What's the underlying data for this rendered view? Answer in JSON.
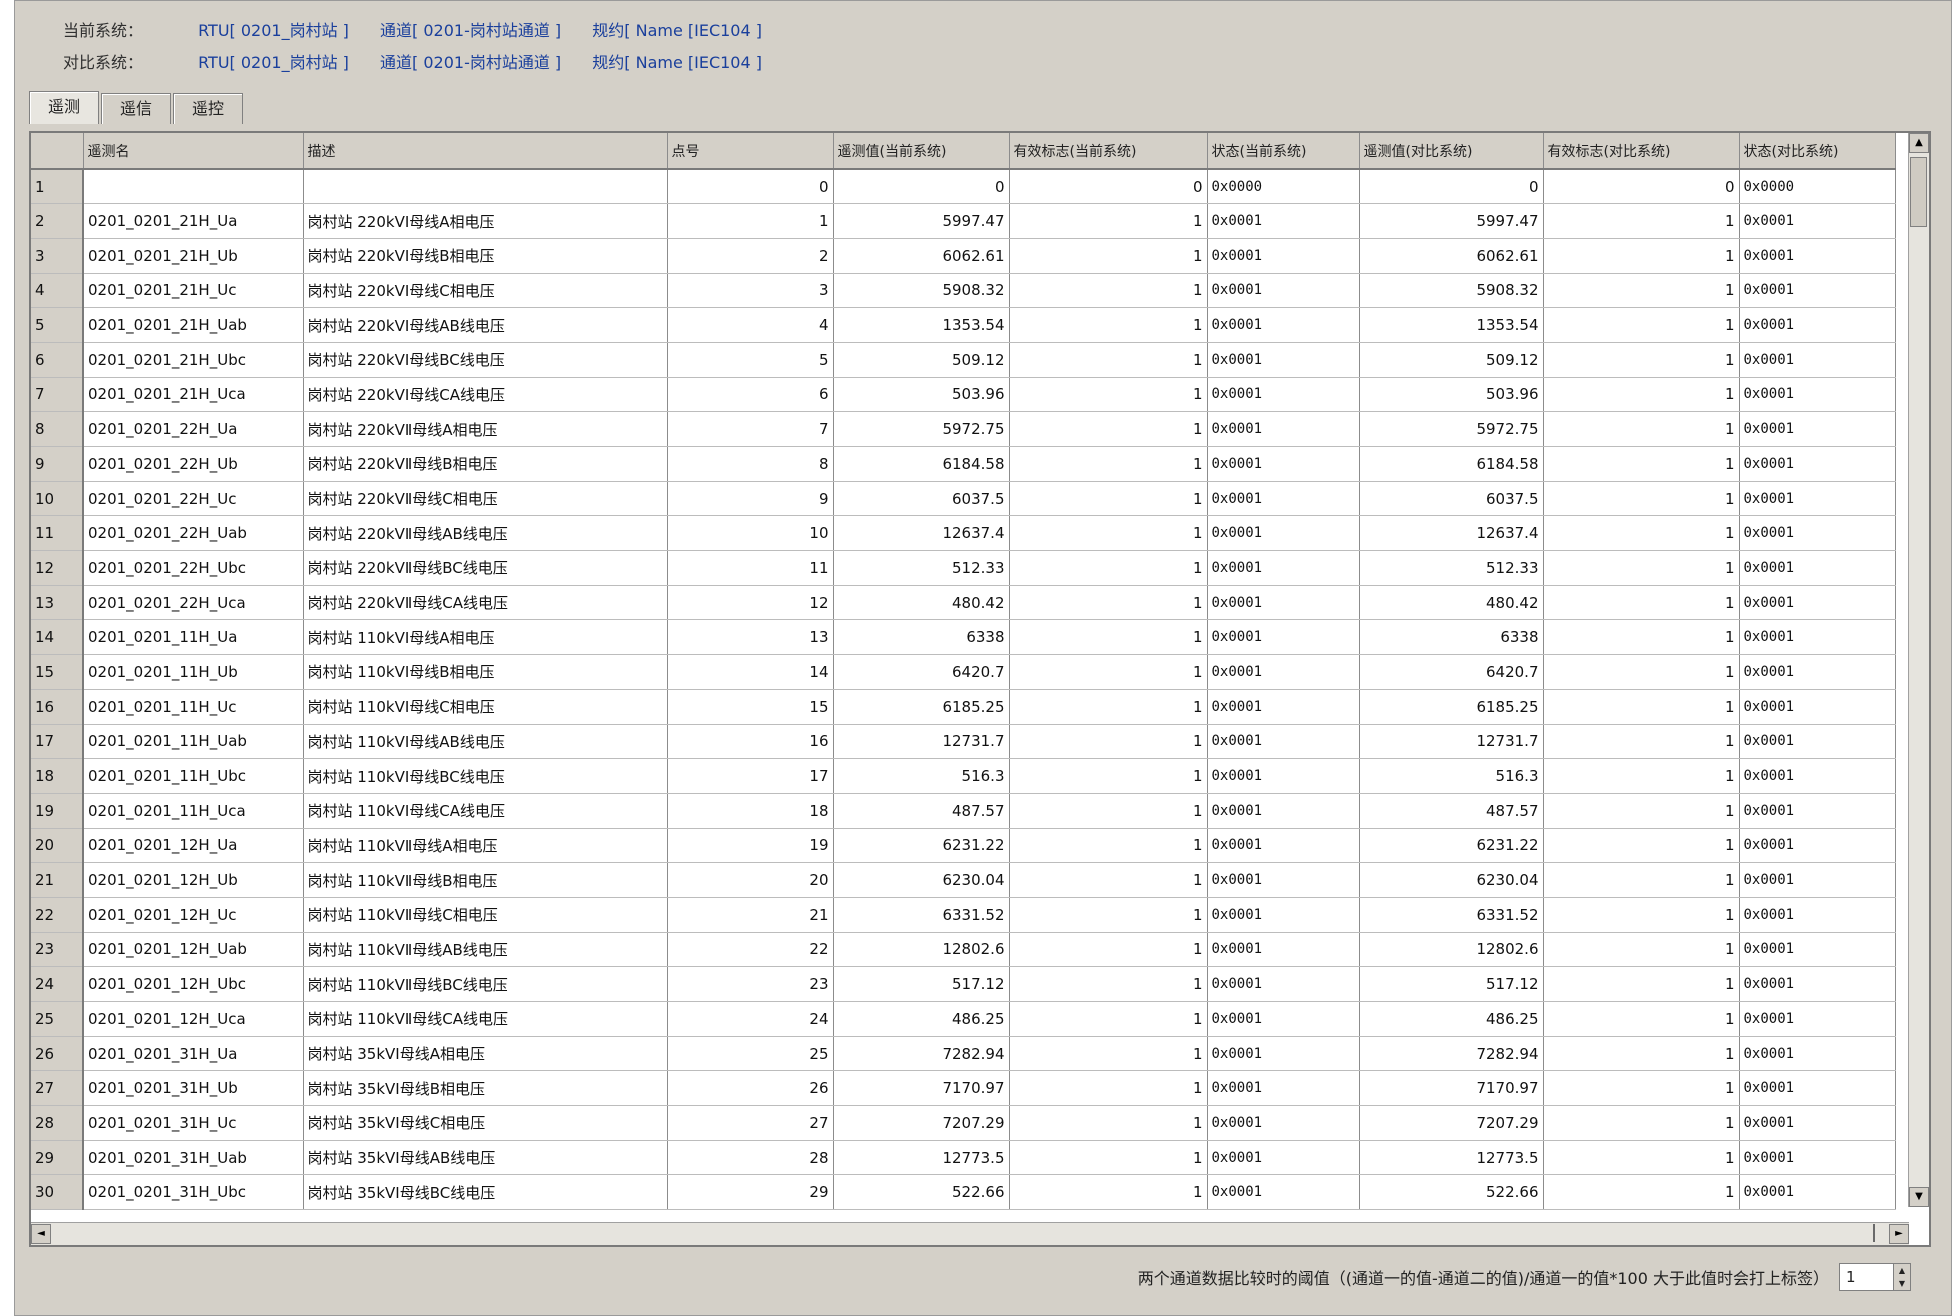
{
  "header": {
    "current_label": "当前系统：",
    "current_rtu": "RTU[ 0201_岗村站 ]",
    "current_channel": "通道[ 0201-岗村站通道 ]",
    "current_protocol": "规约[ Name [IEC104 ]",
    "compare_label": "对比系统：",
    "compare_rtu": "RTU[ 0201_岗村站 ]",
    "compare_channel": "通道[ 0201-岗村站通道 ]",
    "compare_protocol": "规约[ Name [IEC104 ]"
  },
  "tabs": [
    "遥测",
    "遥信",
    "遥控"
  ],
  "columns": [
    "遥测名",
    "描述",
    "点号",
    "遥测值(当前系统)",
    "有效标志(当前系统)",
    "状态(当前系统)",
    "遥测值(对比系统)",
    "有效标志(对比系统)",
    "状态(对比系统)"
  ],
  "rows": [
    [
      "1",
      "",
      "",
      "0",
      "0",
      "0",
      "0x0000",
      "0",
      "0",
      "0x0000"
    ],
    [
      "2",
      "0201_0201_21H_Ua",
      "岗村站 220kVⅠ母线A相电压",
      "1",
      "5997.47",
      "1",
      "0x0001",
      "5997.47",
      "1",
      "0x0001"
    ],
    [
      "3",
      "0201_0201_21H_Ub",
      "岗村站 220kVⅠ母线B相电压",
      "2",
      "6062.61",
      "1",
      "0x0001",
      "6062.61",
      "1",
      "0x0001"
    ],
    [
      "4",
      "0201_0201_21H_Uc",
      "岗村站 220kVⅠ母线C相电压",
      "3",
      "5908.32",
      "1",
      "0x0001",
      "5908.32",
      "1",
      "0x0001"
    ],
    [
      "5",
      "0201_0201_21H_Uab",
      "岗村站 220kVⅠ母线AB线电压",
      "4",
      "1353.54",
      "1",
      "0x0001",
      "1353.54",
      "1",
      "0x0001"
    ],
    [
      "6",
      "0201_0201_21H_Ubc",
      "岗村站 220kVⅠ母线BC线电压",
      "5",
      "509.12",
      "1",
      "0x0001",
      "509.12",
      "1",
      "0x0001"
    ],
    [
      "7",
      "0201_0201_21H_Uca",
      "岗村站 220kVⅠ母线CA线电压",
      "6",
      "503.96",
      "1",
      "0x0001",
      "503.96",
      "1",
      "0x0001"
    ],
    [
      "8",
      "0201_0201_22H_Ua",
      "岗村站 220kVⅡ母线A相电压",
      "7",
      "5972.75",
      "1",
      "0x0001",
      "5972.75",
      "1",
      "0x0001"
    ],
    [
      "9",
      "0201_0201_22H_Ub",
      "岗村站 220kVⅡ母线B相电压",
      "8",
      "6184.58",
      "1",
      "0x0001",
      "6184.58",
      "1",
      "0x0001"
    ],
    [
      "10",
      "0201_0201_22H_Uc",
      "岗村站 220kVⅡ母线C相电压",
      "9",
      "6037.5",
      "1",
      "0x0001",
      "6037.5",
      "1",
      "0x0001"
    ],
    [
      "11",
      "0201_0201_22H_Uab",
      "岗村站 220kVⅡ母线AB线电压",
      "10",
      "12637.4",
      "1",
      "0x0001",
      "12637.4",
      "1",
      "0x0001"
    ],
    [
      "12",
      "0201_0201_22H_Ubc",
      "岗村站 220kVⅡ母线BC线电压",
      "11",
      "512.33",
      "1",
      "0x0001",
      "512.33",
      "1",
      "0x0001"
    ],
    [
      "13",
      "0201_0201_22H_Uca",
      "岗村站 220kVⅡ母线CA线电压",
      "12",
      "480.42",
      "1",
      "0x0001",
      "480.42",
      "1",
      "0x0001"
    ],
    [
      "14",
      "0201_0201_11H_Ua",
      "岗村站 110kVⅠ母线A相电压",
      "13",
      "6338",
      "1",
      "0x0001",
      "6338",
      "1",
      "0x0001"
    ],
    [
      "15",
      "0201_0201_11H_Ub",
      "岗村站 110kVⅠ母线B相电压",
      "14",
      "6420.7",
      "1",
      "0x0001",
      "6420.7",
      "1",
      "0x0001"
    ],
    [
      "16",
      "0201_0201_11H_Uc",
      "岗村站 110kVⅠ母线C相电压",
      "15",
      "6185.25",
      "1",
      "0x0001",
      "6185.25",
      "1",
      "0x0001"
    ],
    [
      "17",
      "0201_0201_11H_Uab",
      "岗村站 110kVⅠ母线AB线电压",
      "16",
      "12731.7",
      "1",
      "0x0001",
      "12731.7",
      "1",
      "0x0001"
    ],
    [
      "18",
      "0201_0201_11H_Ubc",
      "岗村站 110kVⅠ母线BC线电压",
      "17",
      "516.3",
      "1",
      "0x0001",
      "516.3",
      "1",
      "0x0001"
    ],
    [
      "19",
      "0201_0201_11H_Uca",
      "岗村站 110kVⅠ母线CA线电压",
      "18",
      "487.57",
      "1",
      "0x0001",
      "487.57",
      "1",
      "0x0001"
    ],
    [
      "20",
      "0201_0201_12H_Ua",
      "岗村站 110kVⅡ母线A相电压",
      "19",
      "6231.22",
      "1",
      "0x0001",
      "6231.22",
      "1",
      "0x0001"
    ],
    [
      "21",
      "0201_0201_12H_Ub",
      "岗村站 110kVⅡ母线B相电压",
      "20",
      "6230.04",
      "1",
      "0x0001",
      "6230.04",
      "1",
      "0x0001"
    ],
    [
      "22",
      "0201_0201_12H_Uc",
      "岗村站 110kVⅡ母线C相电压",
      "21",
      "6331.52",
      "1",
      "0x0001",
      "6331.52",
      "1",
      "0x0001"
    ],
    [
      "23",
      "0201_0201_12H_Uab",
      "岗村站 110kVⅡ母线AB线电压",
      "22",
      "12802.6",
      "1",
      "0x0001",
      "12802.6",
      "1",
      "0x0001"
    ],
    [
      "24",
      "0201_0201_12H_Ubc",
      "岗村站 110kVⅡ母线BC线电压",
      "23",
      "517.12",
      "1",
      "0x0001",
      "517.12",
      "1",
      "0x0001"
    ],
    [
      "25",
      "0201_0201_12H_Uca",
      "岗村站 110kVⅡ母线CA线电压",
      "24",
      "486.25",
      "1",
      "0x0001",
      "486.25",
      "1",
      "0x0001"
    ],
    [
      "26",
      "0201_0201_31H_Ua",
      "岗村站 35kVⅠ母线A相电压",
      "25",
      "7282.94",
      "1",
      "0x0001",
      "7282.94",
      "1",
      "0x0001"
    ],
    [
      "27",
      "0201_0201_31H_Ub",
      "岗村站 35kVⅠ母线B相电压",
      "26",
      "7170.97",
      "1",
      "0x0001",
      "7170.97",
      "1",
      "0x0001"
    ],
    [
      "28",
      "0201_0201_31H_Uc",
      "岗村站 35kVⅠ母线C相电压",
      "27",
      "7207.29",
      "1",
      "0x0001",
      "7207.29",
      "1",
      "0x0001"
    ],
    [
      "29",
      "0201_0201_31H_Uab",
      "岗村站 35kVⅠ母线AB线电压",
      "28",
      "12773.5",
      "1",
      "0x0001",
      "12773.5",
      "1",
      "0x0001"
    ],
    [
      "30",
      "0201_0201_31H_Ubc",
      "岗村站 35kVⅠ母线BC线电压",
      "29",
      "522.66",
      "1",
      "0x0001",
      "522.66",
      "1",
      "0x0001"
    ]
  ],
  "footer": {
    "label": "两个通道数据比较时的阈值（(通道一的值-通道二的值)/通道一的值*100 大于此值时会打上标签）",
    "threshold": "1"
  },
  "icons": {
    "scroll_up": "▲",
    "scroll_down": "▼",
    "scroll_left": "◄",
    "scroll_right": "►"
  }
}
